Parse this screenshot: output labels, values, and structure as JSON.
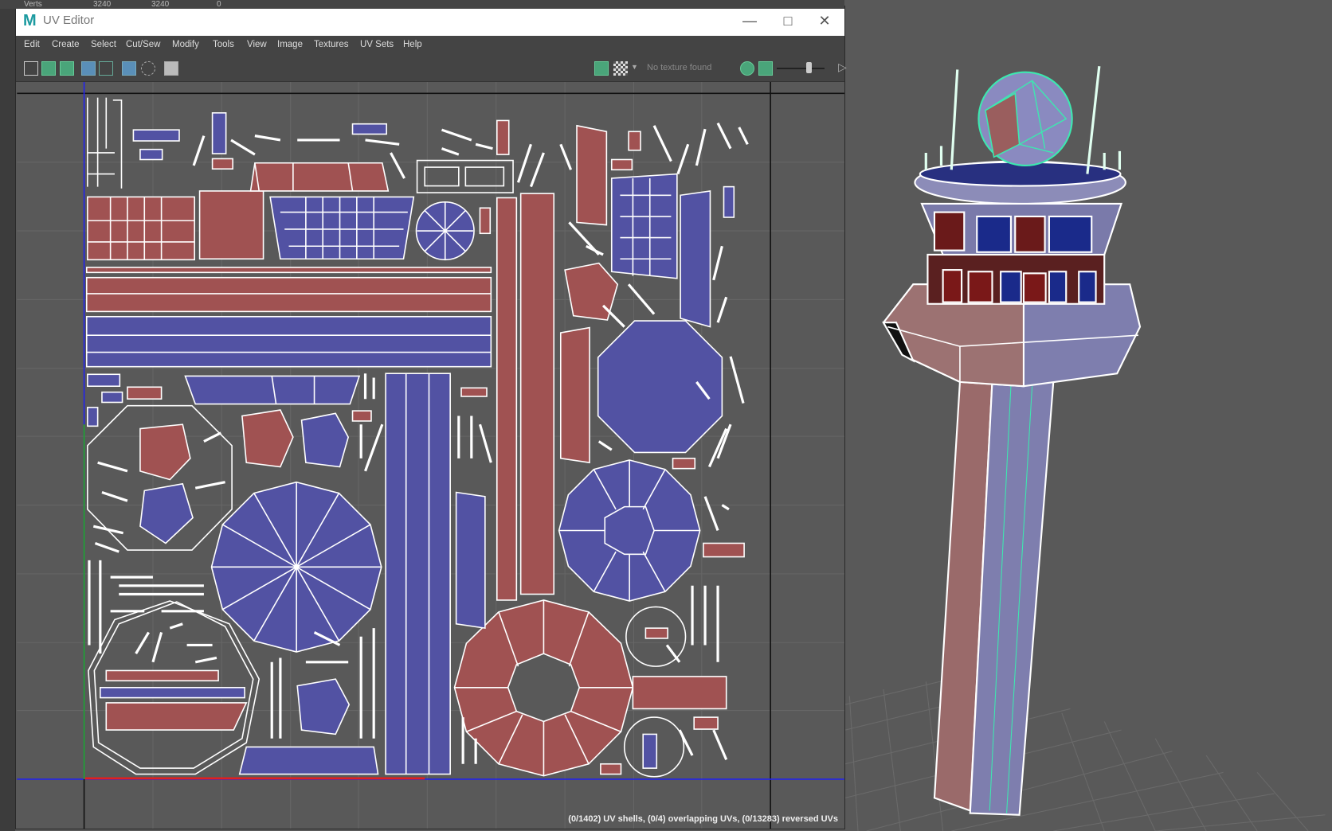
{
  "background_strip": {
    "label": "Verts",
    "v1": "3240",
    "v2": "3240",
    "v3": "0"
  },
  "window": {
    "title": "UV Editor",
    "logo": "M",
    "minimize_icon": "minimize-icon",
    "maximize_icon": "maximize-icon",
    "close_icon": "close-icon"
  },
  "menu": [
    "Edit",
    "Create",
    "Select",
    "Cut/Sew",
    "Modify",
    "Tools",
    "View",
    "Image",
    "Textures",
    "UV Sets",
    "Help"
  ],
  "toolbar": {
    "texture_status": "No texture found"
  },
  "status": "(0/1402) UV shells, (0/4) overlapping UVs, (0/13283) reversed UVs",
  "colors": {
    "shell_red": "#a05252",
    "shell_blue": "#5252a3",
    "wire_green": "#3de8b0",
    "viewport": "#595959"
  }
}
